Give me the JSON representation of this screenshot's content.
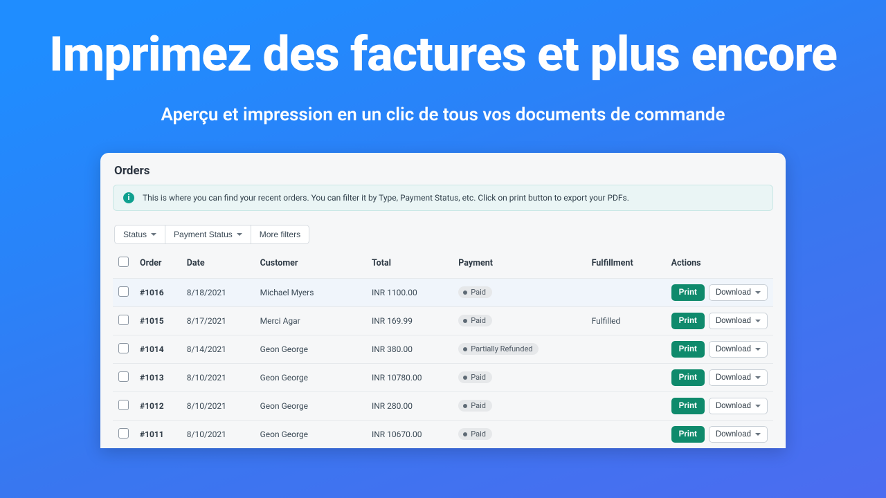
{
  "hero": {
    "title": "Imprimez des factures et plus encore",
    "subtitle": "Aperçu et impression en un clic de tous vos documents de commande"
  },
  "panel": {
    "title": "Orders",
    "info_text": "This is where you can find your recent orders. You can filter it by Type, Payment Status, etc. Click on print button to export your PDFs."
  },
  "filters": {
    "status_label": "Status",
    "payment_status_label": "Payment Status",
    "more_filters_label": "More filters"
  },
  "table": {
    "headers": {
      "order": "Order",
      "date": "Date",
      "customer": "Customer",
      "total": "Total",
      "payment": "Payment",
      "fulfillment": "Fulfillment",
      "actions": "Actions"
    },
    "action_labels": {
      "print": "Print",
      "download": "Download"
    },
    "rows": [
      {
        "order": "#1016",
        "date": "8/18/2021",
        "customer": "Michael Myers",
        "total": "INR 1100.00",
        "payment": "Paid",
        "fulfillment": "",
        "highlight": true
      },
      {
        "order": "#1015",
        "date": "8/17/2021",
        "customer": "Merci Agar",
        "total": "INR 169.99",
        "payment": "Paid",
        "fulfillment": "Fulfilled",
        "highlight": false
      },
      {
        "order": "#1014",
        "date": "8/14/2021",
        "customer": "Geon George",
        "total": "INR 380.00",
        "payment": "Partially Refunded",
        "fulfillment": "",
        "highlight": false
      },
      {
        "order": "#1013",
        "date": "8/10/2021",
        "customer": "Geon George",
        "total": "INR 10780.00",
        "payment": "Paid",
        "fulfillment": "",
        "highlight": false
      },
      {
        "order": "#1012",
        "date": "8/10/2021",
        "customer": "Geon George",
        "total": "INR 280.00",
        "payment": "Paid",
        "fulfillment": "",
        "highlight": false
      },
      {
        "order": "#1011",
        "date": "8/10/2021",
        "customer": "Geon George",
        "total": "INR 10670.00",
        "payment": "Paid",
        "fulfillment": "",
        "highlight": false
      }
    ]
  }
}
